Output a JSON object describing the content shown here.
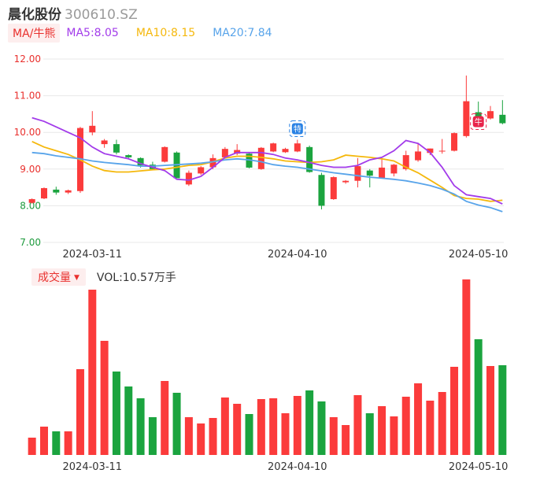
{
  "header": {
    "name": "晨化股份",
    "code": "300610.SZ"
  },
  "legend": {
    "ma_label": "MA/牛熊",
    "ma5": "MA5:8.05",
    "ma10": "MA10:8.15",
    "ma20": "MA20:7.84"
  },
  "volume_legend": {
    "label": "成交量",
    "vol": "VOL:10.57万手"
  },
  "colors": {
    "up": "#fb3b3b",
    "down": "#1ba43f",
    "ma5": "#a23bea",
    "ma10": "#f5b80c",
    "ma20": "#58a4ea",
    "grid": "#e8e8e8"
  },
  "chart_data": [
    {
      "type": "candlestick",
      "y_ticks": [
        "12.00",
        "11.00",
        "10.00",
        "9.00",
        "8.00",
        "7.00"
      ],
      "ylim": [
        7.0,
        12.0
      ],
      "x_ticks": [
        {
          "index": 5,
          "label": "2024-03-11"
        },
        {
          "index": 22,
          "label": "2024-04-10"
        },
        {
          "index": 37,
          "label": "2024-05-10"
        }
      ],
      "candles": [
        {
          "o": 8.08,
          "h": 8.2,
          "l": 8.06,
          "c": 8.18
        },
        {
          "o": 8.2,
          "h": 8.5,
          "l": 8.18,
          "c": 8.48
        },
        {
          "o": 8.44,
          "h": 8.52,
          "l": 8.3,
          "c": 8.36
        },
        {
          "o": 8.36,
          "h": 8.44,
          "l": 8.32,
          "c": 8.42
        },
        {
          "o": 8.4,
          "h": 10.15,
          "l": 8.35,
          "c": 10.12
        },
        {
          "o": 10.0,
          "h": 10.58,
          "l": 9.92,
          "c": 10.18
        },
        {
          "o": 9.68,
          "h": 9.82,
          "l": 9.58,
          "c": 9.78
        },
        {
          "o": 9.68,
          "h": 9.8,
          "l": 9.4,
          "c": 9.45
        },
        {
          "o": 9.38,
          "h": 9.4,
          "l": 9.3,
          "c": 9.32
        },
        {
          "o": 9.3,
          "h": 9.32,
          "l": 9.04,
          "c": 9.1
        },
        {
          "o": 9.12,
          "h": 9.2,
          "l": 8.98,
          "c": 9.0
        },
        {
          "o": 9.2,
          "h": 9.62,
          "l": 9.18,
          "c": 9.6
        },
        {
          "o": 9.45,
          "h": 9.48,
          "l": 8.78,
          "c": 8.75
        },
        {
          "o": 8.58,
          "h": 8.96,
          "l": 8.54,
          "c": 8.9
        },
        {
          "o": 8.88,
          "h": 9.08,
          "l": 8.84,
          "c": 9.05
        },
        {
          "o": 9.05,
          "h": 9.4,
          "l": 9.0,
          "c": 9.3
        },
        {
          "o": 9.32,
          "h": 9.6,
          "l": 9.3,
          "c": 9.55
        },
        {
          "o": 9.42,
          "h": 9.68,
          "l": 9.38,
          "c": 9.52
        },
        {
          "o": 9.42,
          "h": 9.46,
          "l": 9.02,
          "c": 9.04
        },
        {
          "o": 9.0,
          "h": 9.6,
          "l": 8.98,
          "c": 9.58
        },
        {
          "o": 9.48,
          "h": 9.72,
          "l": 9.46,
          "c": 9.7
        },
        {
          "o": 9.46,
          "h": 9.58,
          "l": 9.44,
          "c": 9.55
        },
        {
          "o": 9.48,
          "h": 9.8,
          "l": 9.46,
          "c": 9.7
        },
        {
          "o": 9.6,
          "h": 9.64,
          "l": 8.9,
          "c": 8.92
        },
        {
          "o": 8.84,
          "h": 8.9,
          "l": 7.9,
          "c": 8.0
        },
        {
          "o": 8.18,
          "h": 8.8,
          "l": 8.16,
          "c": 8.78
        },
        {
          "o": 8.64,
          "h": 8.7,
          "l": 8.6,
          "c": 8.68
        },
        {
          "o": 8.68,
          "h": 9.3,
          "l": 8.5,
          "c": 9.08
        },
        {
          "o": 8.96,
          "h": 9.0,
          "l": 8.5,
          "c": 8.82
        },
        {
          "o": 8.76,
          "h": 9.3,
          "l": 8.74,
          "c": 9.04
        },
        {
          "o": 8.88,
          "h": 9.14,
          "l": 8.8,
          "c": 9.12
        },
        {
          "o": 9.0,
          "h": 9.5,
          "l": 8.96,
          "c": 9.38
        },
        {
          "o": 9.24,
          "h": 9.7,
          "l": 9.2,
          "c": 9.48
        },
        {
          "o": 9.44,
          "h": 9.56,
          "l": 9.38,
          "c": 9.56
        },
        {
          "o": 9.5,
          "h": 9.82,
          "l": 9.42,
          "c": 9.5
        },
        {
          "o": 9.5,
          "h": 10.0,
          "l": 9.48,
          "c": 9.98
        },
        {
          "o": 9.9,
          "h": 11.55,
          "l": 9.86,
          "c": 10.85
        },
        {
          "o": 10.55,
          "h": 10.84,
          "l": 10.38,
          "c": 10.42
        },
        {
          "o": 10.38,
          "h": 10.72,
          "l": 10.35,
          "c": 10.58
        },
        {
          "o": 10.48,
          "h": 10.88,
          "l": 10.22,
          "c": 10.25
        }
      ],
      "ma5": [
        10.4,
        10.3,
        10.15,
        10.0,
        9.85,
        9.6,
        9.42,
        9.35,
        9.28,
        9.15,
        9.05,
        8.96,
        8.72,
        8.7,
        8.8,
        9.05,
        9.32,
        9.45,
        9.45,
        9.45,
        9.4,
        9.3,
        9.25,
        9.18,
        9.1,
        9.05,
        9.05,
        9.1,
        9.25,
        9.32,
        9.5,
        9.78,
        9.7,
        9.45,
        9.05,
        8.55,
        8.3,
        8.25,
        8.2,
        8.05
      ],
      "ma10": [
        9.75,
        9.6,
        9.5,
        9.4,
        9.25,
        9.08,
        8.96,
        8.92,
        8.92,
        8.95,
        8.98,
        9.0,
        9.05,
        9.1,
        9.12,
        9.2,
        9.3,
        9.35,
        9.35,
        9.32,
        9.28,
        9.22,
        9.2,
        9.18,
        9.2,
        9.25,
        9.38,
        9.35,
        9.32,
        9.28,
        9.22,
        9.05,
        8.9,
        8.7,
        8.5,
        8.28,
        8.2,
        8.18,
        8.12,
        8.15
      ],
      "ma20": [
        9.45,
        9.42,
        9.36,
        9.32,
        9.28,
        9.22,
        9.18,
        9.15,
        9.12,
        9.08,
        9.08,
        9.1,
        9.12,
        9.14,
        9.16,
        9.2,
        9.25,
        9.28,
        9.25,
        9.2,
        9.12,
        9.08,
        9.05,
        9.0,
        8.95,
        8.9,
        8.86,
        8.82,
        8.78,
        8.75,
        8.72,
        8.68,
        8.62,
        8.55,
        8.45,
        8.32,
        8.12,
        8.02,
        7.95,
        7.84
      ],
      "markers": [
        {
          "index": 22,
          "glyph": "特",
          "color": "#2a82e4"
        },
        {
          "index": 37,
          "glyph": "牛",
          "color": "#e8244b"
        }
      ]
    },
    {
      "type": "bar",
      "name": "成交量",
      "ylim": [
        0,
        21
      ],
      "values": [
        2.2,
        3.6,
        3.0,
        3.0,
        10.9,
        21.0,
        14.5,
        10.6,
        8.7,
        7.2,
        4.8,
        9.4,
        7.9,
        4.8,
        4.0,
        4.7,
        7.3,
        6.5,
        5.2,
        7.1,
        7.2,
        5.3,
        7.5,
        8.2,
        6.8,
        4.8,
        3.8,
        7.6,
        5.3,
        6.2,
        4.9,
        7.4,
        9.1,
        6.9,
        8.0,
        11.2,
        22.3,
        14.7,
        11.3,
        11.4
      ]
    }
  ]
}
